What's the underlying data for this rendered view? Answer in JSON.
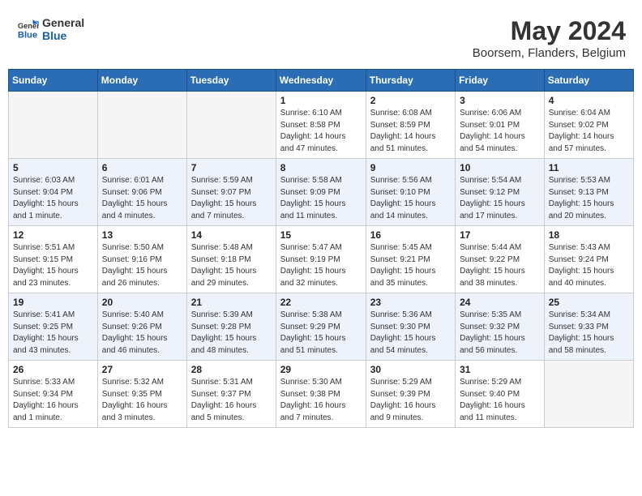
{
  "header": {
    "logo_line1": "General",
    "logo_line2": "Blue",
    "month_year": "May 2024",
    "location": "Boorsem, Flanders, Belgium"
  },
  "days_of_week": [
    "Sunday",
    "Monday",
    "Tuesday",
    "Wednesday",
    "Thursday",
    "Friday",
    "Saturday"
  ],
  "weeks": [
    [
      {
        "day": "",
        "info": ""
      },
      {
        "day": "",
        "info": ""
      },
      {
        "day": "",
        "info": ""
      },
      {
        "day": "1",
        "info": "Sunrise: 6:10 AM\nSunset: 8:58 PM\nDaylight: 14 hours and 47 minutes."
      },
      {
        "day": "2",
        "info": "Sunrise: 6:08 AM\nSunset: 8:59 PM\nDaylight: 14 hours and 51 minutes."
      },
      {
        "day": "3",
        "info": "Sunrise: 6:06 AM\nSunset: 9:01 PM\nDaylight: 14 hours and 54 minutes."
      },
      {
        "day": "4",
        "info": "Sunrise: 6:04 AM\nSunset: 9:02 PM\nDaylight: 14 hours and 57 minutes."
      }
    ],
    [
      {
        "day": "5",
        "info": "Sunrise: 6:03 AM\nSunset: 9:04 PM\nDaylight: 15 hours and 1 minute."
      },
      {
        "day": "6",
        "info": "Sunrise: 6:01 AM\nSunset: 9:06 PM\nDaylight: 15 hours and 4 minutes."
      },
      {
        "day": "7",
        "info": "Sunrise: 5:59 AM\nSunset: 9:07 PM\nDaylight: 15 hours and 7 minutes."
      },
      {
        "day": "8",
        "info": "Sunrise: 5:58 AM\nSunset: 9:09 PM\nDaylight: 15 hours and 11 minutes."
      },
      {
        "day": "9",
        "info": "Sunrise: 5:56 AM\nSunset: 9:10 PM\nDaylight: 15 hours and 14 minutes."
      },
      {
        "day": "10",
        "info": "Sunrise: 5:54 AM\nSunset: 9:12 PM\nDaylight: 15 hours and 17 minutes."
      },
      {
        "day": "11",
        "info": "Sunrise: 5:53 AM\nSunset: 9:13 PM\nDaylight: 15 hours and 20 minutes."
      }
    ],
    [
      {
        "day": "12",
        "info": "Sunrise: 5:51 AM\nSunset: 9:15 PM\nDaylight: 15 hours and 23 minutes."
      },
      {
        "day": "13",
        "info": "Sunrise: 5:50 AM\nSunset: 9:16 PM\nDaylight: 15 hours and 26 minutes."
      },
      {
        "day": "14",
        "info": "Sunrise: 5:48 AM\nSunset: 9:18 PM\nDaylight: 15 hours and 29 minutes."
      },
      {
        "day": "15",
        "info": "Sunrise: 5:47 AM\nSunset: 9:19 PM\nDaylight: 15 hours and 32 minutes."
      },
      {
        "day": "16",
        "info": "Sunrise: 5:45 AM\nSunset: 9:21 PM\nDaylight: 15 hours and 35 minutes."
      },
      {
        "day": "17",
        "info": "Sunrise: 5:44 AM\nSunset: 9:22 PM\nDaylight: 15 hours and 38 minutes."
      },
      {
        "day": "18",
        "info": "Sunrise: 5:43 AM\nSunset: 9:24 PM\nDaylight: 15 hours and 40 minutes."
      }
    ],
    [
      {
        "day": "19",
        "info": "Sunrise: 5:41 AM\nSunset: 9:25 PM\nDaylight: 15 hours and 43 minutes."
      },
      {
        "day": "20",
        "info": "Sunrise: 5:40 AM\nSunset: 9:26 PM\nDaylight: 15 hours and 46 minutes."
      },
      {
        "day": "21",
        "info": "Sunrise: 5:39 AM\nSunset: 9:28 PM\nDaylight: 15 hours and 48 minutes."
      },
      {
        "day": "22",
        "info": "Sunrise: 5:38 AM\nSunset: 9:29 PM\nDaylight: 15 hours and 51 minutes."
      },
      {
        "day": "23",
        "info": "Sunrise: 5:36 AM\nSunset: 9:30 PM\nDaylight: 15 hours and 54 minutes."
      },
      {
        "day": "24",
        "info": "Sunrise: 5:35 AM\nSunset: 9:32 PM\nDaylight: 15 hours and 56 minutes."
      },
      {
        "day": "25",
        "info": "Sunrise: 5:34 AM\nSunset: 9:33 PM\nDaylight: 15 hours and 58 minutes."
      }
    ],
    [
      {
        "day": "26",
        "info": "Sunrise: 5:33 AM\nSunset: 9:34 PM\nDaylight: 16 hours and 1 minute."
      },
      {
        "day": "27",
        "info": "Sunrise: 5:32 AM\nSunset: 9:35 PM\nDaylight: 16 hours and 3 minutes."
      },
      {
        "day": "28",
        "info": "Sunrise: 5:31 AM\nSunset: 9:37 PM\nDaylight: 16 hours and 5 minutes."
      },
      {
        "day": "29",
        "info": "Sunrise: 5:30 AM\nSunset: 9:38 PM\nDaylight: 16 hours and 7 minutes."
      },
      {
        "day": "30",
        "info": "Sunrise: 5:29 AM\nSunset: 9:39 PM\nDaylight: 16 hours and 9 minutes."
      },
      {
        "day": "31",
        "info": "Sunrise: 5:29 AM\nSunset: 9:40 PM\nDaylight: 16 hours and 11 minutes."
      },
      {
        "day": "",
        "info": ""
      }
    ]
  ]
}
